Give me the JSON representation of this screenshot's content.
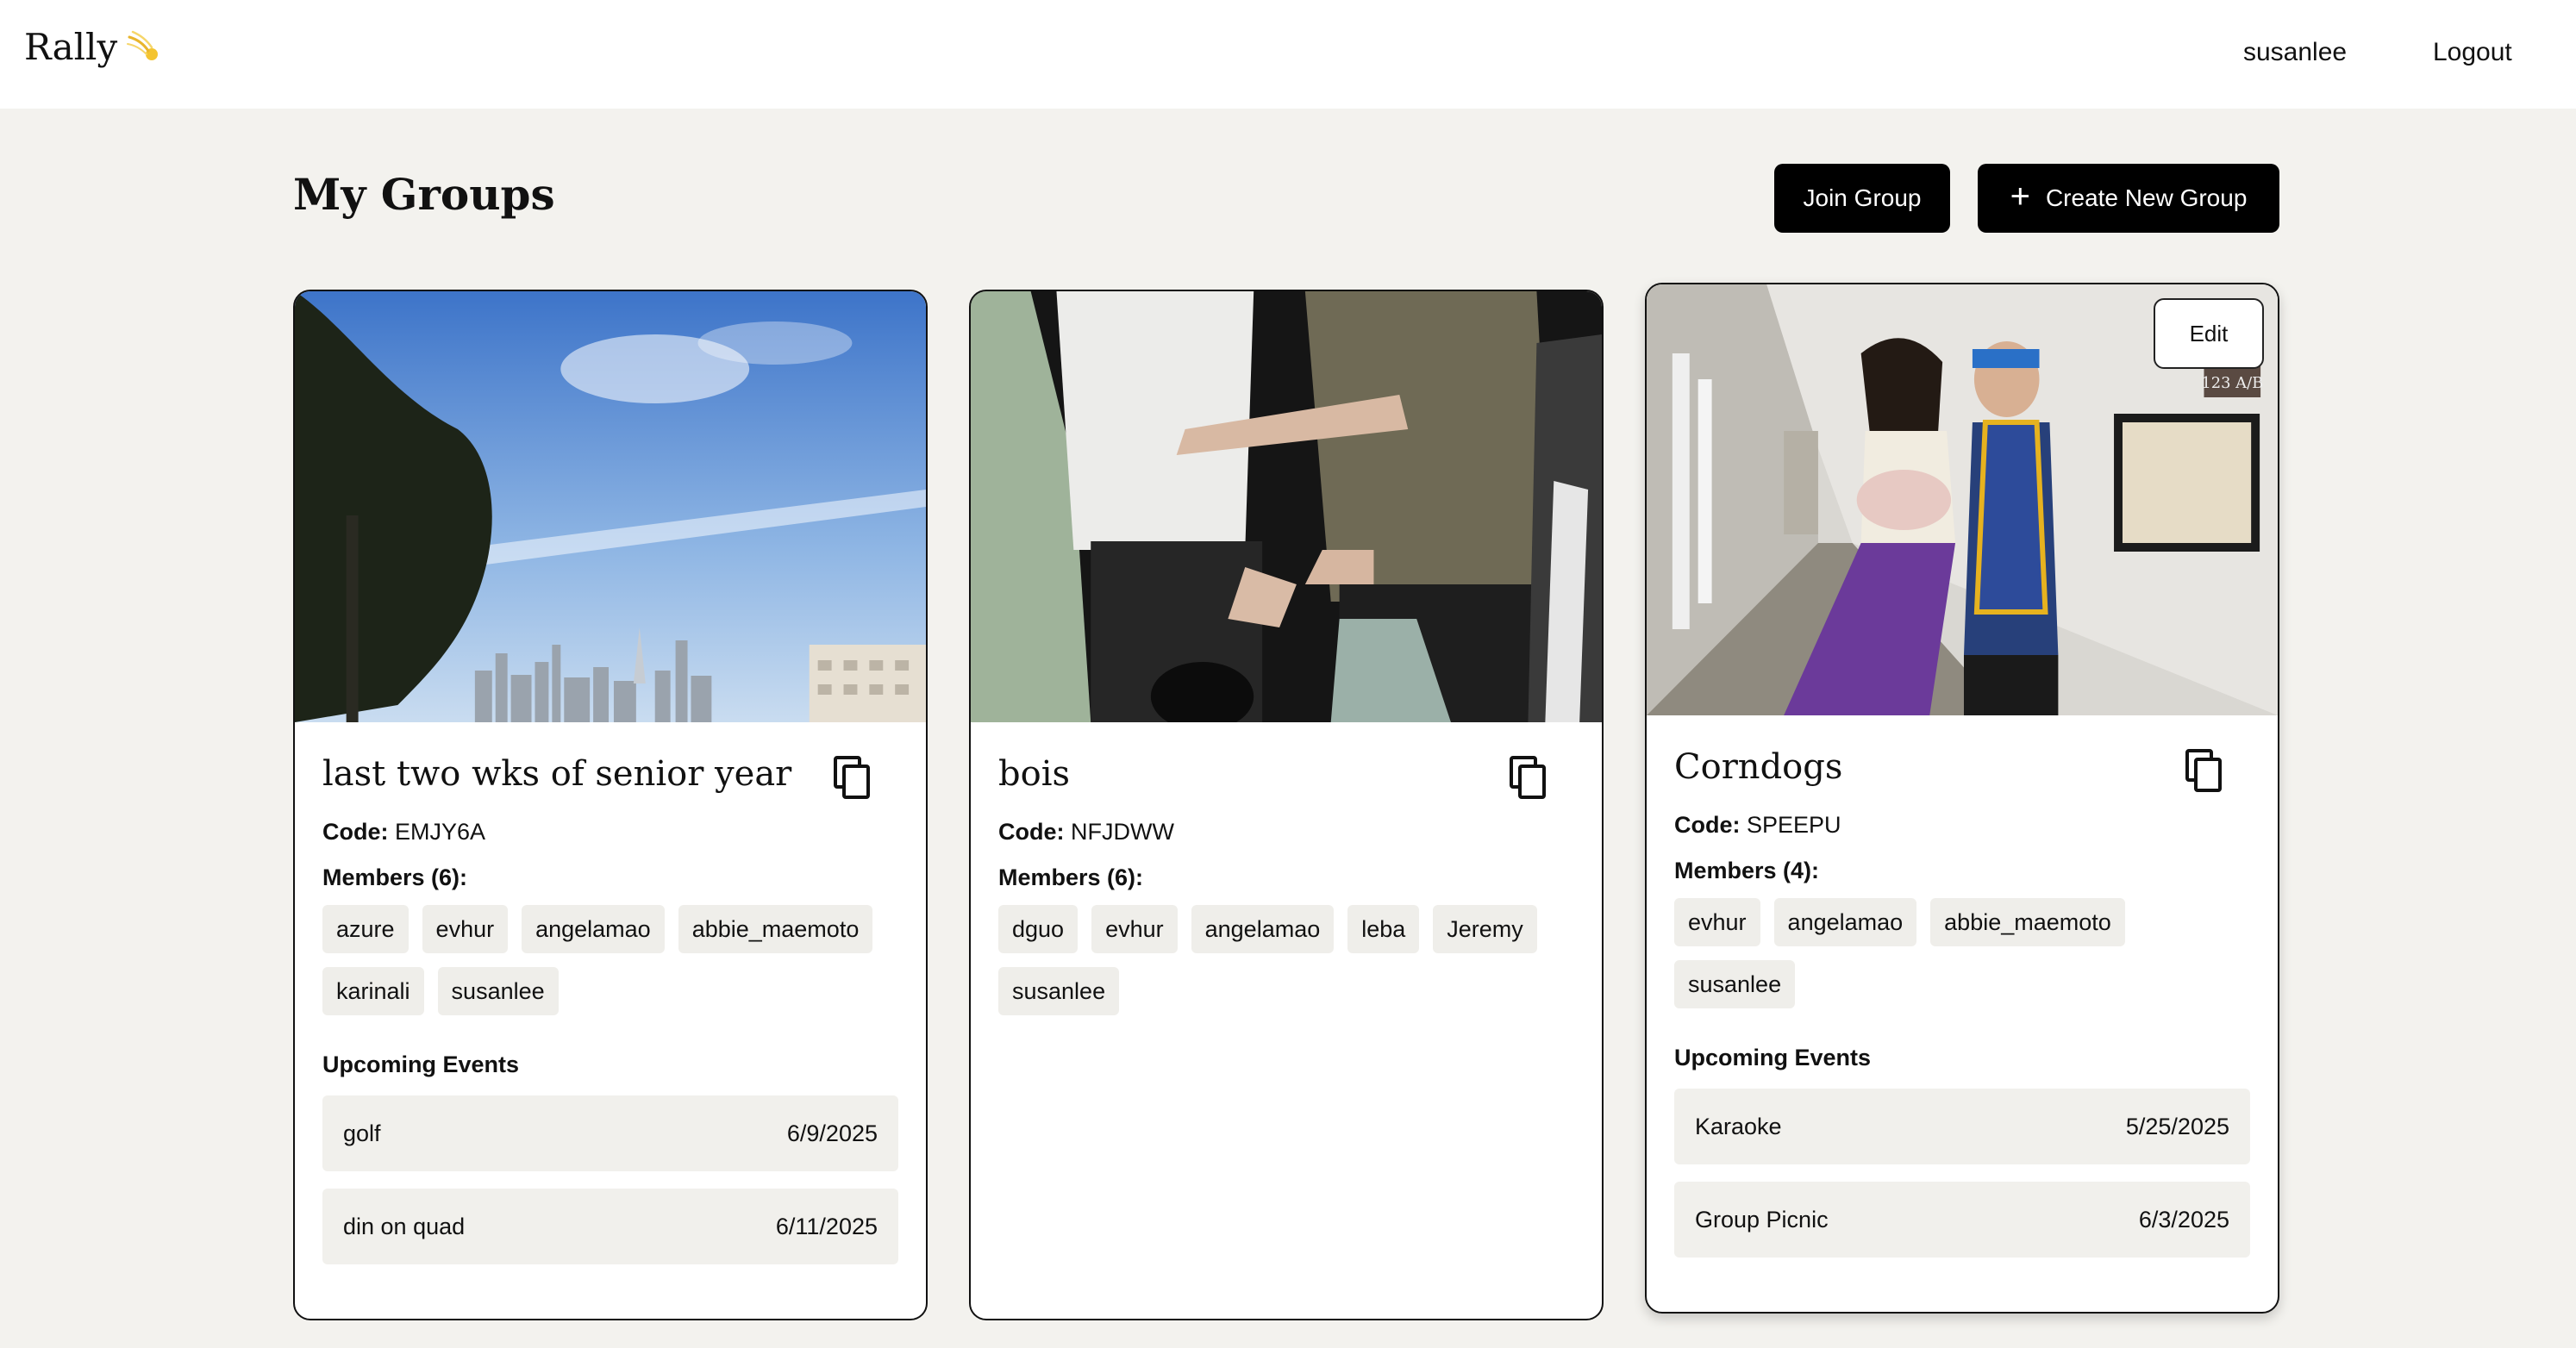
{
  "header": {
    "brand": "Rally",
    "brand_icon": "comet-icon",
    "username": "susanlee",
    "logout_label": "Logout"
  },
  "page": {
    "title": "My Groups",
    "join_label": "Join Group",
    "create_label": "Create New Group"
  },
  "labels": {
    "code": "Code:",
    "upcoming": "Upcoming Events",
    "edit": "Edit"
  },
  "groups": [
    {
      "name": "last two wks of senior year",
      "code": "EMJY6A",
      "members_label": "Members (6):",
      "members": [
        "azure",
        "evhur",
        "angelamao",
        "abbie_maemoto",
        "karinali",
        "susanlee"
      ],
      "events": [
        {
          "name": "golf",
          "date": "6/9/2025"
        },
        {
          "name": "din on quad",
          "date": "6/11/2025"
        }
      ]
    },
    {
      "name": "bois",
      "code": "NFJDWW",
      "members_label": "Members (6):",
      "members": [
        "dguo",
        "evhur",
        "angelamao",
        "leba",
        "Jeremy",
        "susanlee"
      ],
      "events": []
    },
    {
      "name": "Corndogs",
      "code": "SPEEPU",
      "members_label": "Members (4):",
      "members": [
        "evhur",
        "angelamao",
        "abbie_maemoto",
        "susanlee"
      ],
      "events": [
        {
          "name": "Karaoke",
          "date": "5/25/2025"
        },
        {
          "name": "Group Picnic",
          "date": "6/3/2025"
        }
      ]
    }
  ],
  "colors": {
    "page_bg": "#f3f2ee",
    "button_bg": "#000000",
    "chip_bg": "#efeeea"
  }
}
